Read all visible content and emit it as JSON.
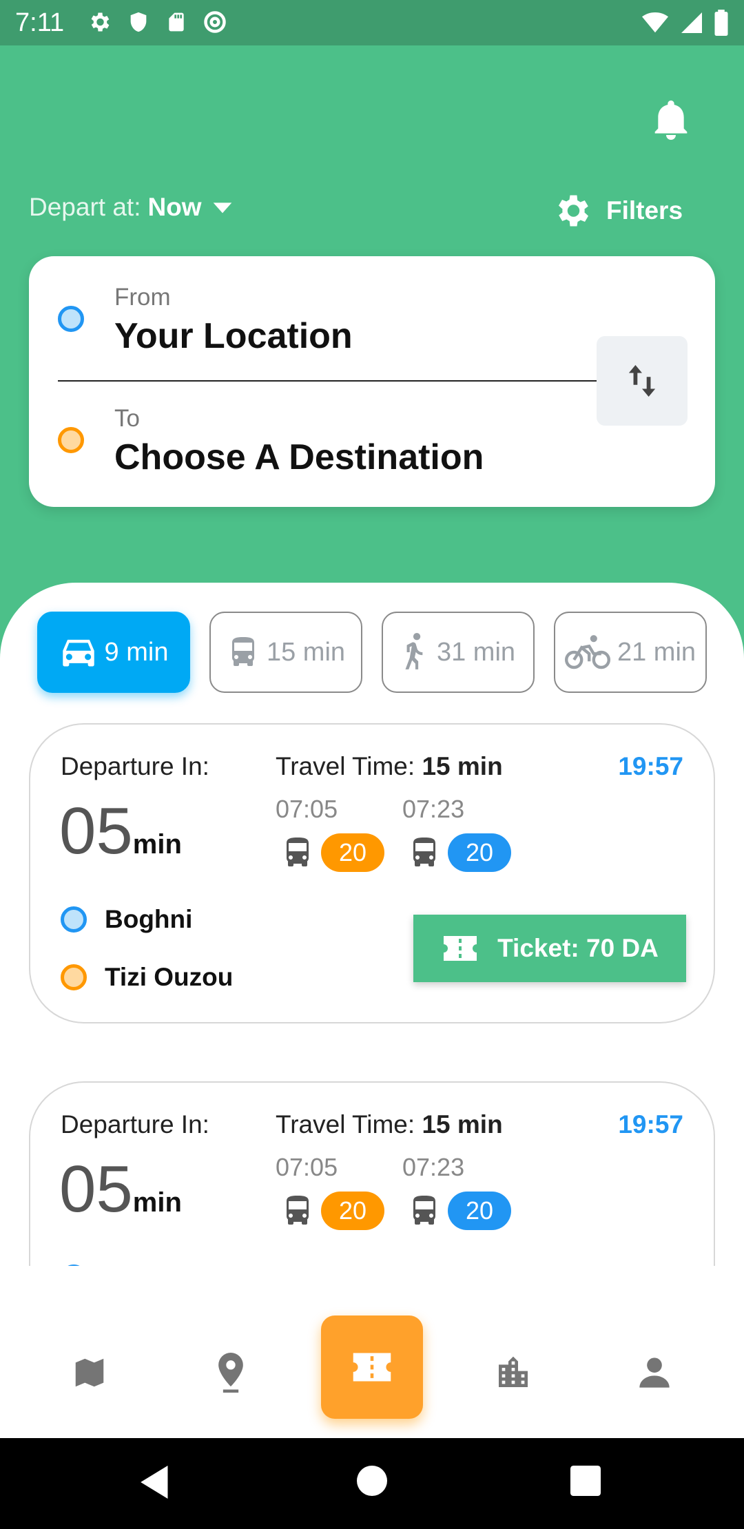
{
  "status_bar": {
    "time": "7:11",
    "left_icons": [
      "settings-icon",
      "shield-icon",
      "sd-card-icon",
      "at-sign-icon"
    ],
    "right_icons": [
      "wifi-icon",
      "signal-icon",
      "battery-icon"
    ]
  },
  "header": {
    "depart_label": "Depart at:",
    "depart_value": "Now",
    "filters_label": "Filters"
  },
  "route": {
    "from_label": "From",
    "from_value": "Your Location",
    "to_label": "To",
    "to_value": "Choose A Destination"
  },
  "modes": [
    {
      "icon": "car-icon",
      "label": "9 min",
      "active": true
    },
    {
      "icon": "bus-icon",
      "label": "15 min",
      "active": false
    },
    {
      "icon": "walk-icon",
      "label": "31 min",
      "active": false
    },
    {
      "icon": "bike-icon",
      "label": "21 min",
      "active": false
    }
  ],
  "trips": [
    {
      "departure_label": "Departure In:",
      "departure_value": "05",
      "departure_unit": "min",
      "travel_label": "Travel Time:",
      "travel_value": "15 min",
      "arrival": "19:57",
      "leg1_time": "07:05",
      "leg1_line": "20",
      "leg2_time": "07:23",
      "leg2_line": "20",
      "origin": "Boghni",
      "destination": "Tizi Ouzou",
      "ticket_label": "Ticket: 70 DA"
    },
    {
      "departure_label": "Departure In:",
      "departure_value": "05",
      "departure_unit": "min",
      "travel_label": "Travel Time:",
      "travel_value": "15 min",
      "arrival": "19:57",
      "leg1_time": "07:05",
      "leg1_line": "20",
      "leg2_time": "07:23",
      "leg2_line": "20"
    }
  ],
  "bottom_nav": [
    {
      "icon": "map-icon"
    },
    {
      "icon": "location-pin-icon"
    },
    {
      "icon": "ticket-icon",
      "active": true
    },
    {
      "icon": "city-icon"
    },
    {
      "icon": "person-icon"
    }
  ],
  "colors": {
    "primary_green": "#4cc089",
    "status_green": "#3f9c6e",
    "accent_blue": "#00a9f4",
    "line_orange": "#ff9800",
    "line_blue": "#2196f3",
    "nav_orange": "#ffa12b"
  }
}
